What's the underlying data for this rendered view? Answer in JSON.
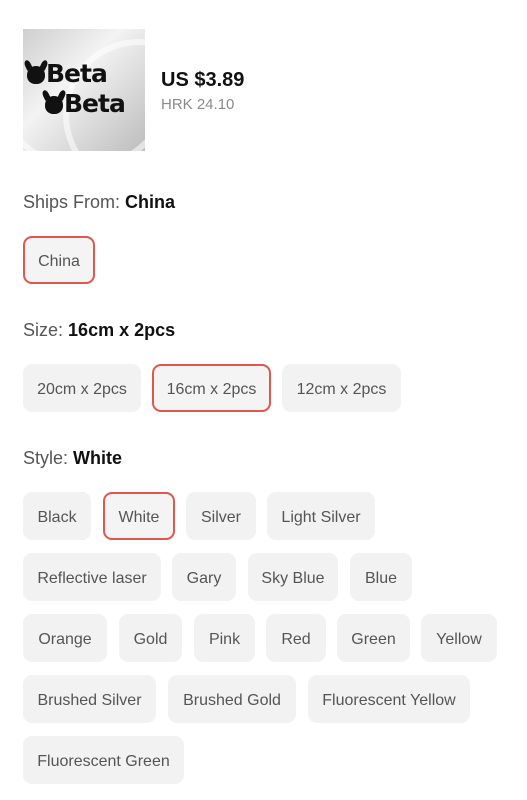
{
  "product": {
    "thumbnail_text": [
      "Beta",
      "Beta"
    ],
    "price": "US $3.89",
    "alt_price": "HRK 24.10"
  },
  "ships_from": {
    "label": "Ships From:",
    "value": "China",
    "options": [
      {
        "label": "China",
        "selected": true
      }
    ]
  },
  "size": {
    "label": "Size:",
    "value": "16cm x 2pcs",
    "options": [
      {
        "label": "20cm x 2pcs",
        "selected": false
      },
      {
        "label": "16cm x 2pcs",
        "selected": true
      },
      {
        "label": "12cm x 2pcs",
        "selected": false
      }
    ]
  },
  "style": {
    "label": "Style:",
    "value": "White",
    "options": [
      {
        "label": "Black",
        "selected": false
      },
      {
        "label": "White",
        "selected": true
      },
      {
        "label": "Silver",
        "selected": false
      },
      {
        "label": "Light Silver",
        "selected": false
      },
      {
        "label": "Reflective laser",
        "selected": false
      },
      {
        "label": "Gary",
        "selected": false
      },
      {
        "label": "Sky Blue",
        "selected": false
      },
      {
        "label": "Blue",
        "selected": false
      },
      {
        "label": "Orange",
        "selected": false
      },
      {
        "label": "Gold",
        "selected": false
      },
      {
        "label": "Pink",
        "selected": false
      },
      {
        "label": "Red",
        "selected": false
      },
      {
        "label": "Green",
        "selected": false
      },
      {
        "label": "Yellow",
        "selected": false
      },
      {
        "label": "Brushed Silver",
        "selected": false
      },
      {
        "label": "Brushed Gold",
        "selected": false
      },
      {
        "label": "Fluorescent Yellow",
        "selected": false
      },
      {
        "label": "Fluorescent Green",
        "selected": false
      }
    ]
  },
  "colors": {
    "selected_border": "#e0574b",
    "chip_bg": "#f2f2f2"
  }
}
